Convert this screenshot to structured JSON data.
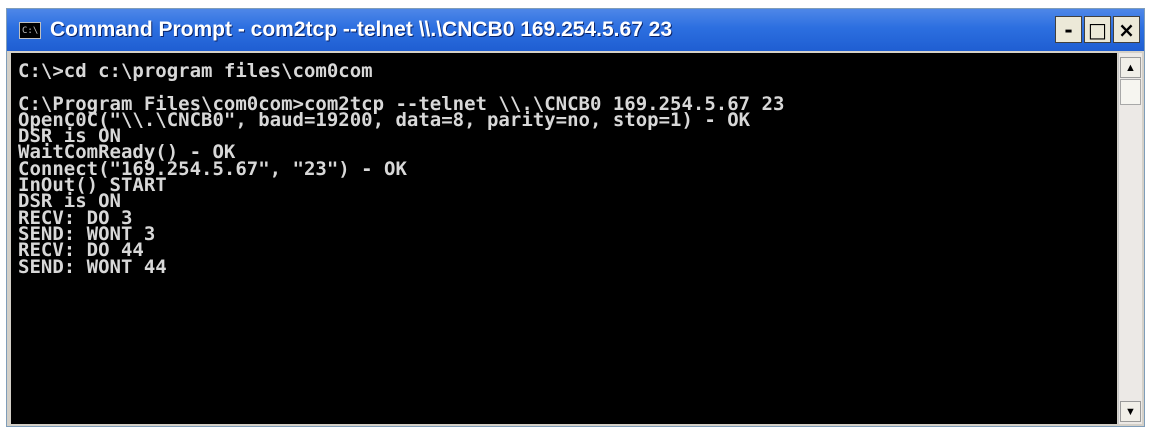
{
  "window": {
    "title": "Command Prompt - com2tcp --telnet \\\\.\\CNCB0 169.254.5.67 23",
    "icon_text": "C:\\",
    "buttons": {
      "minimize": "-",
      "maximize": "□",
      "close": "×"
    }
  },
  "console": {
    "lines": [
      "C:\\>cd c:\\program files\\com0com",
      "",
      "C:\\Program Files\\com0com>com2tcp --telnet \\\\.\\CNCB0 169.254.5.67 23",
      "OpenC0C(\"\\\\.\\CNCB0\", baud=19200, data=8, parity=no, stop=1) - OK",
      "DSR is ON",
      "WaitComReady() - OK",
      "Connect(\"169.254.5.67\", \"23\") - OK",
      "InOut() START",
      "DSR is ON",
      "RECV: DO 3",
      "SEND: WONT 3",
      "RECV: DO 44",
      "SEND: WONT 44"
    ]
  },
  "scrollbar": {
    "up_icon": "arrow-up-icon",
    "down_icon": "arrow-down-icon"
  }
}
